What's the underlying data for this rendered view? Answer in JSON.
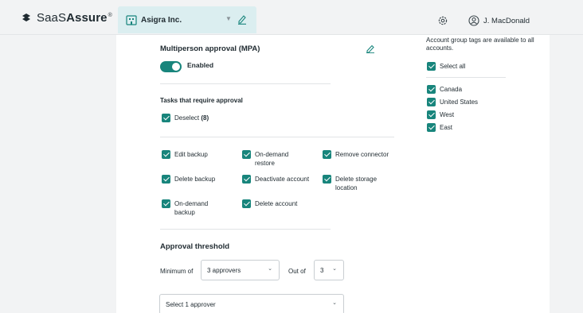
{
  "brand": {
    "prefix": "SaaS",
    "bold": "Assure",
    "mark": "®"
  },
  "org": {
    "name": "Asigra Inc."
  },
  "user": {
    "name": "J. MacDonald"
  },
  "mpa": {
    "title": "Multiperson approval (MPA)",
    "enabled": true,
    "toggle_label": "Enabled",
    "tasks_heading": "Tasks that require approval",
    "deselect_label": "Deselect",
    "deselect_count": "(8)",
    "tasks": [
      {
        "label": "Edit backup",
        "checked": true
      },
      {
        "label": "On-demand restore",
        "checked": true
      },
      {
        "label": "Remove connector",
        "checked": true
      },
      {
        "label": "Delete backup",
        "checked": true
      },
      {
        "label": "Deactivate account",
        "checked": true
      },
      {
        "label": "Delete storage location",
        "checked": true
      },
      {
        "label": "On-demand backup",
        "checked": true
      },
      {
        "label": "Delete account",
        "checked": true
      }
    ]
  },
  "threshold": {
    "title": "Approval threshold",
    "minimum_label": "Minimum of",
    "minimum_value": "3 approvers",
    "outof_label": "Out of",
    "outof_value": "3",
    "approver_placeholder": "Select 1 approver"
  },
  "tags": {
    "note": "Account group tags are available to all accounts.",
    "select_all": "Select all",
    "items": [
      {
        "label": "Canada",
        "checked": true
      },
      {
        "label": "United States",
        "checked": true
      },
      {
        "label": "West",
        "checked": true
      },
      {
        "label": "East",
        "checked": true
      }
    ]
  },
  "colors": {
    "accent": "#18857c",
    "org_bg": "#dbeef0",
    "chrome_bg": "#f2f3f4"
  },
  "icons": [
    "saasassure-logo-icon",
    "building-icon",
    "chevron-down-icon",
    "pencil-icon",
    "gear-icon",
    "user-icon",
    "checkbox-checked-icon"
  ]
}
